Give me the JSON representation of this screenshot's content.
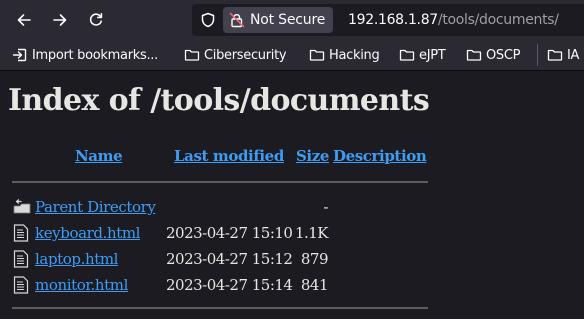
{
  "browser": {
    "security_label": "Not Secure",
    "url_host": "192.168.1.87",
    "url_path": "/tools/documents/",
    "bookmarks": [
      {
        "label": "Import bookmarks...",
        "icon": "import-icon"
      },
      {
        "label": "Cibersecurity",
        "icon": "folder-icon"
      },
      {
        "label": "Hacking",
        "icon": "folder-icon"
      },
      {
        "label": "eJPT",
        "icon": "folder-icon"
      },
      {
        "label": "OSCP",
        "icon": "folder-icon"
      },
      {
        "label": "IA",
        "icon": "folder-icon"
      }
    ]
  },
  "page": {
    "title": "Index of /tools/documents",
    "columns": {
      "name": "Name",
      "last_modified": "Last modified",
      "size": "Size",
      "description": "Description"
    },
    "rows": [
      {
        "name": "Parent Directory",
        "modified": "",
        "size": "-",
        "icon": "back-folder-icon"
      },
      {
        "name": "keyboard.html",
        "modified": "2023-04-27 15:10",
        "size": "1.1K",
        "icon": "text-file-icon"
      },
      {
        "name": "laptop.html",
        "modified": "2023-04-27 15:12",
        "size": "879",
        "icon": "text-file-icon"
      },
      {
        "name": "monitor.html",
        "modified": "2023-04-27 15:14",
        "size": "841",
        "icon": "text-file-icon"
      }
    ]
  },
  "colors": {
    "chrome": "#2b2a33",
    "page_background": "#1c1b22",
    "link": "#3d9df5",
    "text": "#e8e6e3"
  }
}
